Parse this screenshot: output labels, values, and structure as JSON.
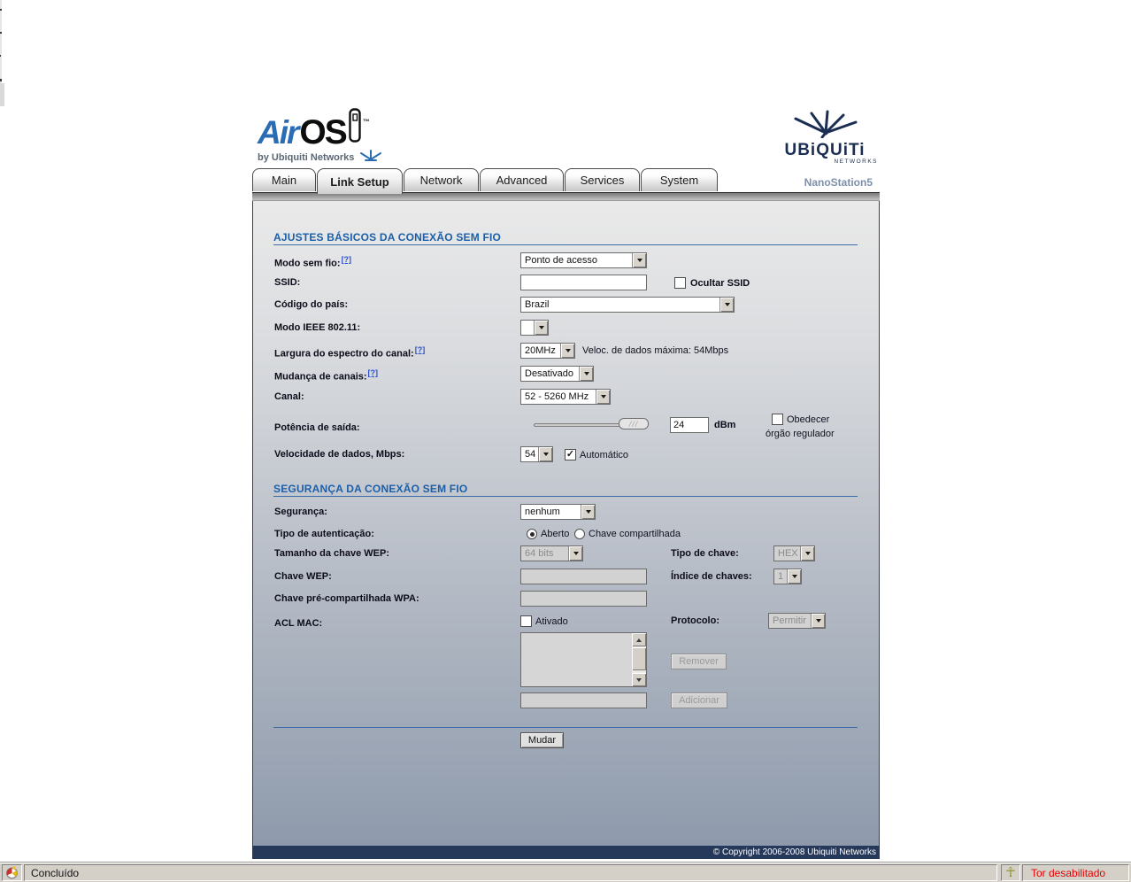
{
  "logo": {
    "air": "Air",
    "os": "OS",
    "tm": "™",
    "byline": "by Ubiquiti Networks"
  },
  "brand": {
    "name": "UBiQUiTi",
    "sub": "NETWORKS",
    "device": "NanoStation5"
  },
  "tabs": [
    {
      "label": "Main",
      "active": false
    },
    {
      "label": "Link Setup",
      "active": true
    },
    {
      "label": "Network",
      "active": false
    },
    {
      "label": "Advanced",
      "active": false
    },
    {
      "label": "Services",
      "active": false
    },
    {
      "label": "System",
      "active": false
    }
  ],
  "misc": {
    "help": "[?]"
  },
  "icons": {
    "check": "✓",
    "slider_grip": "///",
    "ankh": "☥"
  },
  "basic": {
    "title": "AJUSTES BÁSICOS DA CONEXÃO SEM FIO",
    "wireless_mode": {
      "label": "Modo sem fio:",
      "value": "Ponto de acesso"
    },
    "ssid": {
      "label": "SSID:",
      "value": "",
      "hide_label": "Ocultar SSID"
    },
    "country": {
      "label": "Código do país:",
      "value": "Brazil"
    },
    "ieee_mode": {
      "label": "Modo IEEE 802.11:",
      "value": ""
    },
    "spectrum": {
      "label": "Largura do espectro do canal:",
      "value": "20MHz",
      "note": "Veloc. de dados máxima: 54Mbps"
    },
    "channel_shift": {
      "label": "Mudança de canais:",
      "value": "Desativado"
    },
    "channel": {
      "label": "Canal:",
      "value": "52 - 5260 MHz"
    },
    "power": {
      "label": "Potência de saída:",
      "value": "24",
      "unit": "dBm",
      "obey1": "Obedecer",
      "obey2": "órgão regulador"
    },
    "rate": {
      "label": "Velocidade de dados, Mbps:",
      "value": "54",
      "auto_label": "Automático"
    }
  },
  "security": {
    "title": "SEGURANÇA DA CONEXÃO SEM FIO",
    "mode": {
      "label": "Segurança:",
      "value": "nenhum"
    },
    "auth": {
      "label": "Tipo de autenticação:",
      "open": "Aberto",
      "shared": "Chave compartilhada"
    },
    "wep_length": {
      "label": "Tamanho da chave WEP:",
      "value": "64 bits"
    },
    "key_type": {
      "label": "Tipo de chave:",
      "value": "HEX"
    },
    "wep_key": {
      "label": "Chave WEP:",
      "value": ""
    },
    "key_index": {
      "label": "Índice de chaves:",
      "value": "1"
    },
    "wpa_key": {
      "label": "Chave pré-compartilhada WPA:",
      "value": ""
    },
    "acl": {
      "label": "ACL MAC:",
      "enabled_label": "Ativado",
      "mac_value": ""
    },
    "protocol": {
      "label": "Protocolo:",
      "value": "Permitir"
    },
    "remove": "Remover",
    "add": "Adicionar"
  },
  "actions": {
    "change": "Mudar"
  },
  "footer": {
    "copyright": "© Copyright 2006-2008 Ubiquiti Networks"
  },
  "statusbar": {
    "status": "Concluído",
    "tor": "Tor desabilitado"
  },
  "colors": {
    "accent_blue": "#1c5fa8",
    "footer_navy": "#26395a",
    "status_red": "#e60000",
    "link_blue": "#2b50c8",
    "brand_navy": "#1b2d52"
  }
}
